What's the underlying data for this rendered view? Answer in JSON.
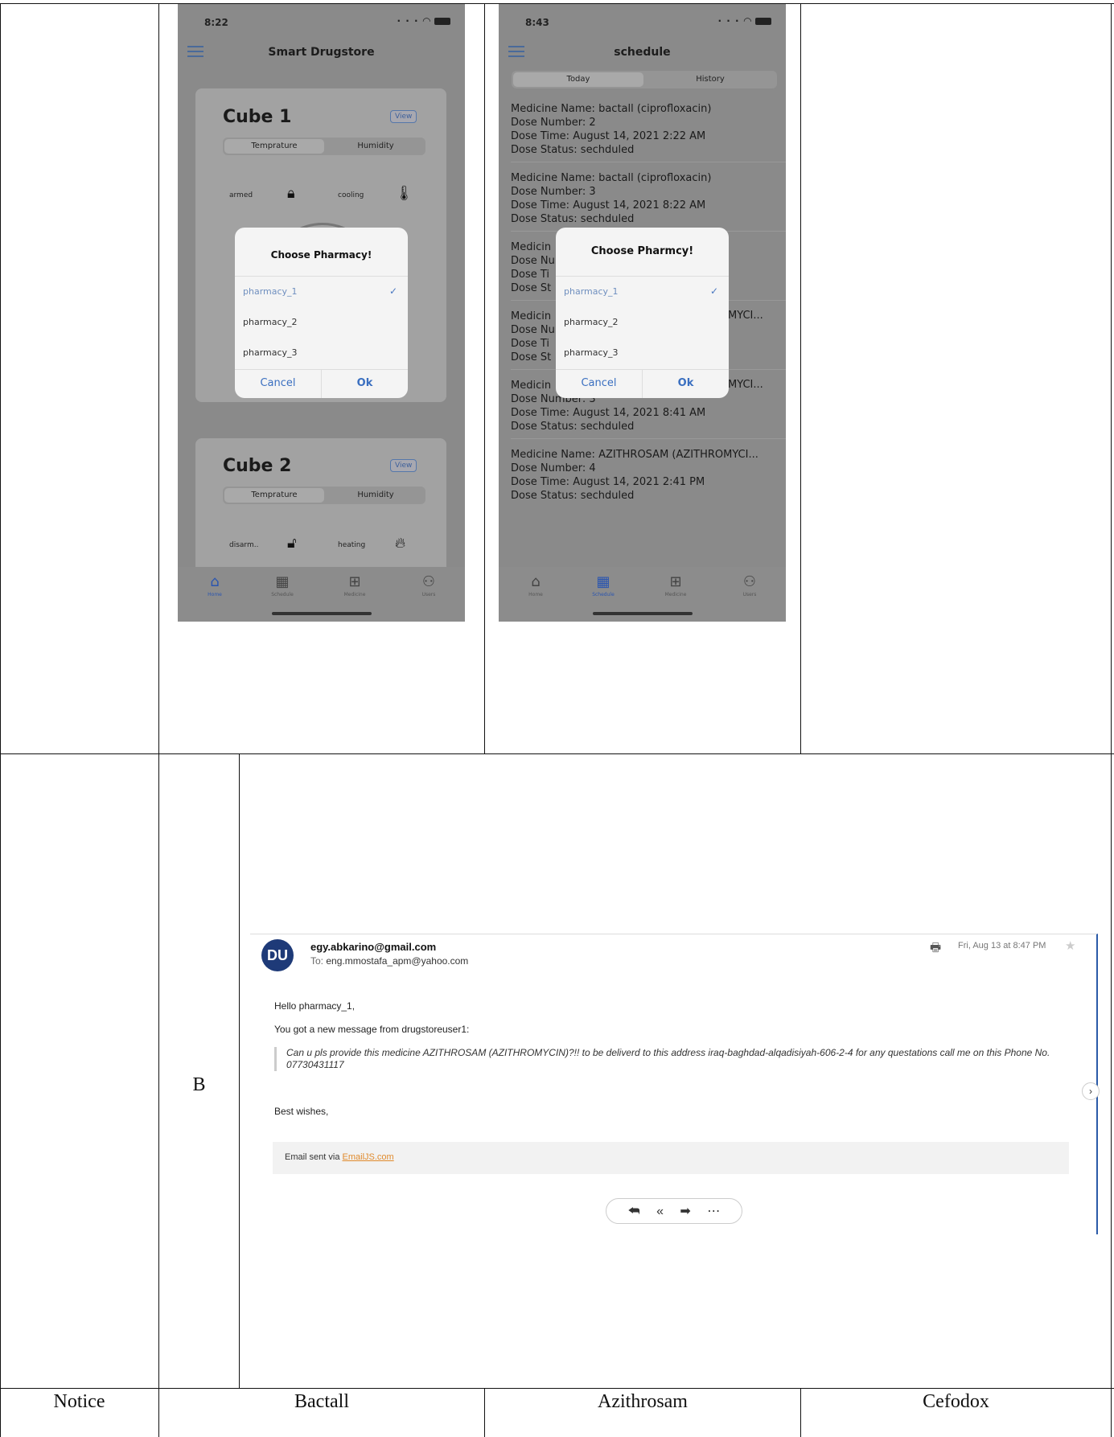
{
  "screen1": {
    "time": "8:22",
    "title": "Smart Drugstore",
    "cube1": {
      "name": "Cube 1",
      "view": "View",
      "seg_left": "Temprature",
      "seg_right": "Humidity",
      "label_a": "armed",
      "label_b": "cooling"
    },
    "cube2": {
      "name": "Cube 2",
      "view": "View",
      "seg_left": "Temprature",
      "seg_right": "Humidity",
      "label_a": "disarm..",
      "label_b": "heating"
    },
    "dialog": {
      "title": "Choose Pharmacy!",
      "options": [
        "pharmacy_1",
        "pharmacy_2",
        "pharmacy_3"
      ],
      "selected": "pharmacy_1",
      "cancel": "Cancel",
      "ok": "Ok"
    },
    "tabs": [
      "Home",
      "Schedule",
      "Medicine",
      "Users"
    ],
    "active_tab": "Home"
  },
  "screen2": {
    "time": "8:43",
    "title": "schedule",
    "seg_left": "Today",
    "seg_right": "History",
    "entries": [
      {
        "name": "Medicine Name: bactall (ciprofloxacin)",
        "number": "Dose Number: 2",
        "time": "Dose Time: August 14, 2021 2:22 AM",
        "status": "Dose Status: sechduled"
      },
      {
        "name": "Medicine Name: bactall (ciprofloxacin)",
        "number": "Dose Number: 3",
        "time": "Dose Time: August 14, 2021 8:22 AM",
        "status": "Dose Status: sechduled"
      },
      {
        "name": "Medicin",
        "number": "Dose Nu",
        "time": "Dose Ti",
        "status": "Dose St"
      },
      {
        "name": "Medicin",
        "name_tail": "MYCI...",
        "number": "Dose Nu",
        "time": "Dose Ti",
        "status": "Dose St"
      },
      {
        "name": "Medicin",
        "name_tail": "MYCI...",
        "number": "Dose Number: 3",
        "time": "Dose Time: August 14, 2021 8:41 AM",
        "status": "Dose Status: sechduled"
      },
      {
        "name": "Medicine Name: AZITHROSAM (AZITHROMYCI...",
        "number": "Dose Number: 4",
        "time": "Dose Time: August 14, 2021 2:41 PM",
        "status": "Dose Status: sechduled"
      }
    ],
    "dialog": {
      "title": "Choose Pharmcy!",
      "options": [
        "pharmacy_1",
        "pharmacy_2",
        "pharmacy_3"
      ],
      "selected": "pharmacy_1",
      "cancel": "Cancel",
      "ok": "Ok"
    },
    "tabs": [
      "Home",
      "Schedule",
      "Medicine",
      "Users"
    ],
    "active_tab": "Schedule"
  },
  "email": {
    "avatar": "DU",
    "from": "egy.abkarino@gmail.com",
    "to_label": "To:",
    "to": "eng.mmostafa_apm@yahoo.com",
    "date": "Fri, Aug 13 at 8:47 PM",
    "greeting": "Hello pharmacy_1,",
    "intro": "You got a new message from drugstoreuser1:",
    "quote": "Can u pls provide this medicine AZITHROSAM (AZITHROMYCIN)?!! to be deliverd to this address iraq-baghdad-alqadisiyah-606-2-4 for any questations call me on this Phone No. 07730431117",
    "signoff": "Best wishes,",
    "footer_prefix": "Email sent via ",
    "footer_link": "EmailJS.com",
    "icons": [
      "printer-icon",
      "star-icon",
      "reply-icon",
      "reply-all-icon",
      "forward-icon",
      "more-icon"
    ]
  },
  "table": {
    "row_label_b": "B",
    "footer": [
      "Notice",
      "Bactall",
      "Azithrosam",
      "Cefodox"
    ]
  }
}
